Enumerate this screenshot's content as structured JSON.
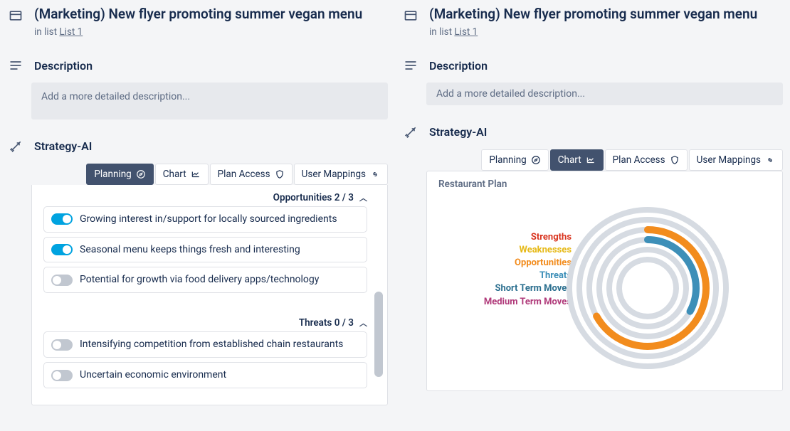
{
  "card": {
    "title": "(Marketing) New flyer promoting summer vegan menu",
    "in_list_prefix": "in list ",
    "list_name": "List 1"
  },
  "description": {
    "heading": "Description",
    "placeholder": "Add a more detailed description..."
  },
  "strategy": {
    "heading": "Strategy-AI",
    "tabs": {
      "planning": "Planning",
      "chart": "Chart",
      "plan_access": "Plan Access",
      "user_mappings": "User Mappings"
    },
    "opportunities": {
      "label": "Opportunities 2 / 3",
      "items": [
        {
          "on": true,
          "text": "Growing interest in/support for locally sourced ingredients"
        },
        {
          "on": true,
          "text": "Seasonal menu keeps things fresh and interesting"
        },
        {
          "on": false,
          "text": "Potential for growth via food delivery apps/technology"
        }
      ]
    },
    "threats": {
      "label": "Threats 0 / 3",
      "items": [
        {
          "on": false,
          "text": "Intensifying competition from established chain restaurants"
        },
        {
          "on": false,
          "text": "Uncertain economic environment"
        }
      ]
    },
    "chart": {
      "title": "Restaurant Plan",
      "legend": [
        {
          "label": "Strengths",
          "color": "#d9341f"
        },
        {
          "label": "Weaknesses",
          "color": "#e6b917"
        },
        {
          "label": "Opportunities",
          "color": "#f28c1d"
        },
        {
          "label": "Threats",
          "color": "#3d8fb8"
        },
        {
          "label": "Short Term Moves",
          "color": "#2b6f8f"
        },
        {
          "label": "Medium Term Moves",
          "color": "#b03a7a"
        }
      ]
    }
  },
  "chart_data": {
    "type": "radial-bar",
    "title": "Restaurant Plan",
    "series": [
      {
        "name": "Strengths",
        "value": 0,
        "color": "#d9341f"
      },
      {
        "name": "Weaknesses",
        "value": 0,
        "color": "#e6b917"
      },
      {
        "name": "Opportunities",
        "value": 0.67,
        "color": "#f28c1d"
      },
      {
        "name": "Threats",
        "value": 0.33,
        "color": "#3d8fb8"
      },
      {
        "name": "Short Term Moves",
        "value": 0,
        "color": "#2b6f8f"
      },
      {
        "name": "Medium Term Moves",
        "value": 0,
        "color": "#b03a7a"
      }
    ],
    "range": [
      0,
      1
    ]
  }
}
